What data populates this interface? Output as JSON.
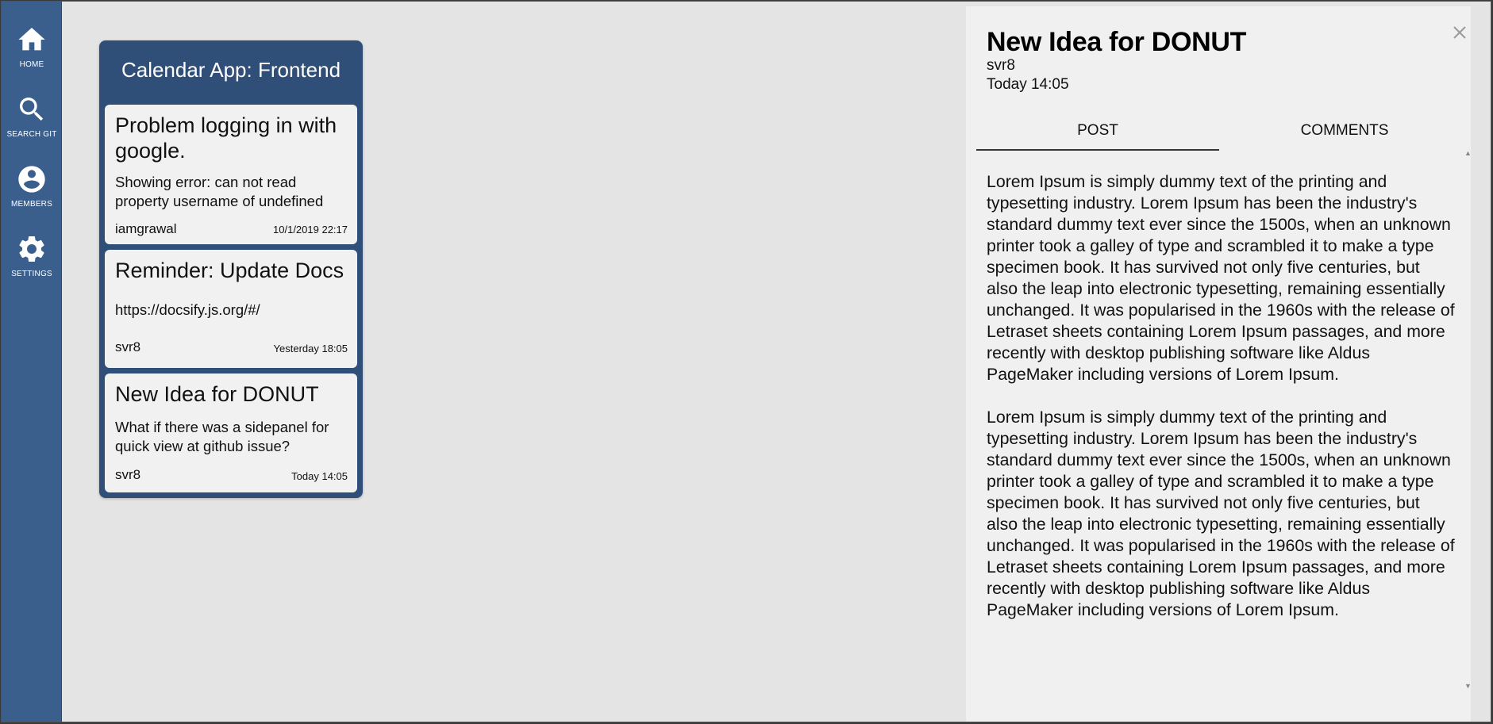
{
  "sidebar": {
    "items": [
      {
        "label": "HOME",
        "icon": "home-icon"
      },
      {
        "label": "SEARCH GIT",
        "icon": "search-icon"
      },
      {
        "label": "MEMBERS",
        "icon": "account-circle-icon"
      },
      {
        "label": "SETTINGS",
        "icon": "gear-icon"
      }
    ]
  },
  "board": {
    "title": "Calendar App: Frontend",
    "cards": [
      {
        "title": "Problem logging in with google.",
        "body": "Showing error: can not read property username of undefined",
        "author": "iamgrawal",
        "time": "10/1/2019 22:17"
      },
      {
        "title": "Reminder: Update Docs",
        "body": "https://docsify.js.org/#/",
        "author": "svr8",
        "time": "Yesterday 18:05"
      },
      {
        "title": "New Idea for DONUT",
        "body": "What if there was a sidepanel for quick view at github issue?",
        "author": "svr8",
        "time": "Today 14:05"
      }
    ]
  },
  "panel": {
    "title": "New Idea for DONUT",
    "author": "svr8",
    "time": "Today 14:05",
    "tabs": [
      {
        "label": "POST",
        "active": true
      },
      {
        "label": "COMMENTS",
        "active": false
      }
    ],
    "paragraphs": [
      "Lorem Ipsum is simply dummy text of the printing and typesetting industry. Lorem Ipsum has been the industry's standard dummy text ever since the 1500s, when an unknown printer took a galley of type and scrambled it to make a type specimen book. It has survived not only five centuries, but also the leap into electronic typesetting, remaining essentially unchanged. It was popularised in the 1960s with the release of Letraset sheets containing Lorem Ipsum passages, and more recently with desktop publishing software like Aldus PageMaker including versions of Lorem Ipsum.",
      "Lorem Ipsum is simply dummy text of the printing and typesetting industry. Lorem Ipsum has been the industry's standard dummy text ever since the 1500s, when an unknown printer took a galley of type and scrambled it to make a type specimen book. It has survived not only five centuries, but also the leap into electronic typesetting, remaining essentially unchanged. It was popularised in the 1960s with the release of Letraset sheets containing Lorem Ipsum passages, and more recently with desktop publishing software like Aldus PageMaker including versions of Lorem Ipsum."
    ]
  },
  "colors": {
    "sidebar": "#3b5f8d",
    "board": "#2f4f78",
    "card": "#f1f1f1",
    "background": "#e4e4e4",
    "panel": "#f0f0f0"
  }
}
